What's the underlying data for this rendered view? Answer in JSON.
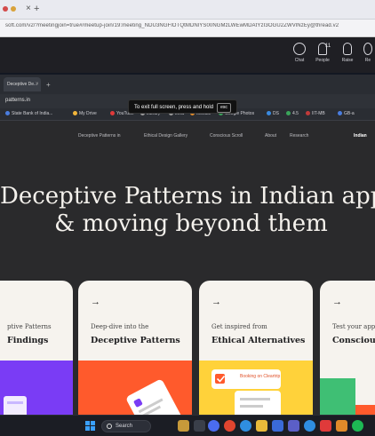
{
  "outer_browser": {
    "tab_close": "×",
    "tab_new": "+",
    "url": "soft.com/v2/?meetingjoin=true#/meetup-join/19:meeting_NDU3NGFlOTQtMDNlYS00NGMzLWEwMDAtYzI3OGU2ZWVlNzEy@thread.v2"
  },
  "meeting_toolbar": {
    "items": [
      {
        "label": "Chat"
      },
      {
        "label": "People",
        "count": "11"
      },
      {
        "label": "Raise"
      },
      {
        "label": "Re"
      }
    ]
  },
  "shared_browser": {
    "tab_title": "Deceptive De...",
    "tab_close": "×",
    "tab_new": "+",
    "url": "patterns.in",
    "toast_text": "To exit full screen, press and hold",
    "toast_key": "esc",
    "bookmarks": [
      "State Bank of India...",
      "My Drive",
      "YouTube",
      "Library",
      "LMS",
      "Moodle",
      "Google Photos",
      "DS",
      "4.5",
      "IIT-MB",
      "GB-a"
    ]
  },
  "site": {
    "nav": [
      "Deceptive Patterns in",
      "Ethical Design Gallery",
      "Conscious Scroll",
      "About",
      "Research",
      "Indian"
    ],
    "hero_line1": "Deceptive Patterns in Indian apps",
    "hero_line2": "& moving beyond them",
    "cards": [
      {
        "arrow": "→",
        "pre": "ptive Patterns",
        "head": "Findings"
      },
      {
        "arrow": "→",
        "pre": "Deep-dive into the",
        "head": "Deceptive Patterns"
      },
      {
        "arrow": "→",
        "pre": "Get inspired from",
        "head": "Ethical Alternatives",
        "art_text": "Booking on Cleartrip"
      },
      {
        "arrow": "→",
        "pre": "Test your app",
        "head": "Consciou"
      }
    ]
  },
  "taskbar": {
    "search_label": "Search"
  },
  "colors": {
    "page_bg": "#131722",
    "site_bg": "#2a2a2c",
    "card_bg": "#f6f3ee",
    "purple": "#7a3cf5",
    "orange": "#ff5a2c",
    "yellow": "#ffd23a",
    "green": "#3fbf74"
  }
}
